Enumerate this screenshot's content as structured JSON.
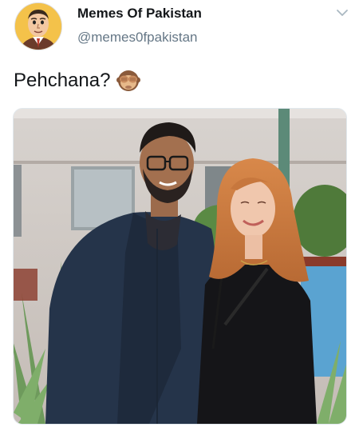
{
  "tweet": {
    "author": {
      "display_name": "Memes Of Pakistan",
      "handle": "@memes0fpakistan",
      "avatar_icon": "cartoon-man-avatar"
    },
    "menu_icon": "chevron-down-icon",
    "text": "Pehchana?",
    "emoji": "see-no-evil-monkey-emoji",
    "media": {
      "description_icon": "photo-of-couple"
    }
  },
  "colors": {
    "text_primary": "#14171a",
    "text_secondary": "#657786",
    "border": "#e1e8ed"
  }
}
